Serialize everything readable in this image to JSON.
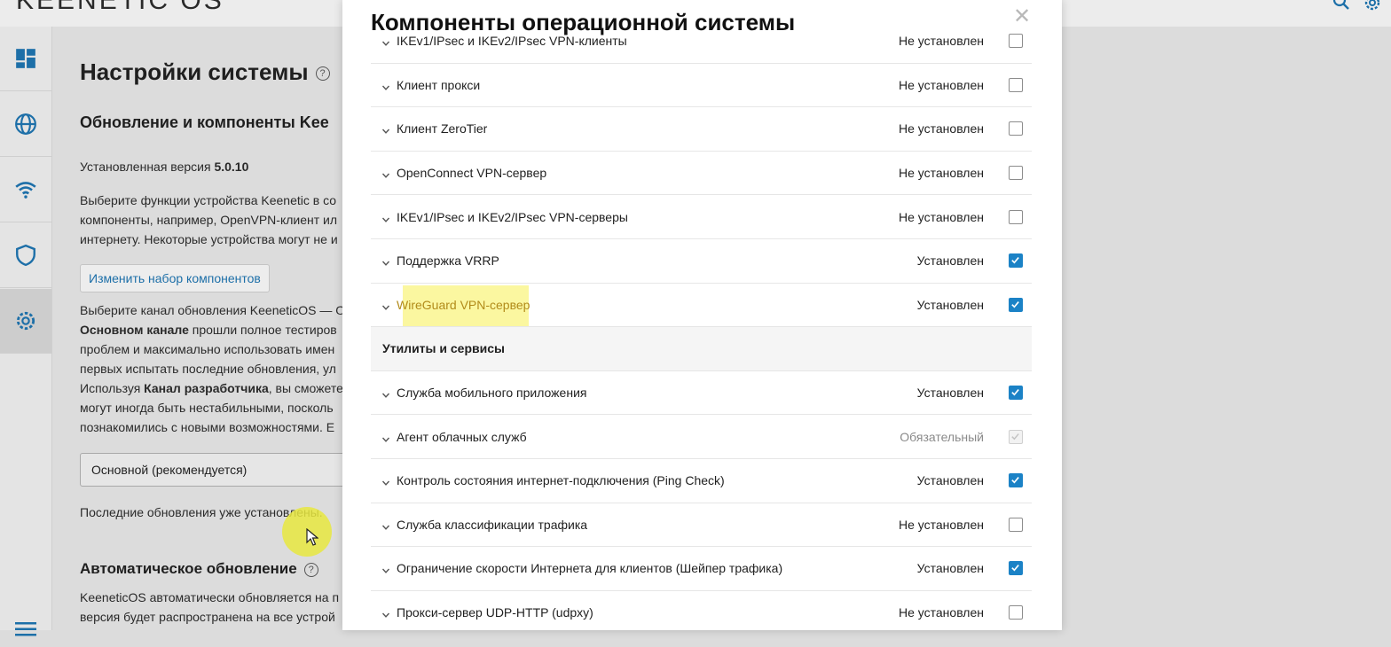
{
  "app": {
    "brand": "KEENETIC OS",
    "top_icons": [
      "search-icon",
      "gear-icon"
    ],
    "accent_color": "#1b82c6"
  },
  "sidebar": {
    "items": [
      {
        "id": "dashboard",
        "icon": "dashboard-icon"
      },
      {
        "id": "internet",
        "icon": "globe-icon"
      },
      {
        "id": "wifi",
        "icon": "wifi-icon"
      },
      {
        "id": "security",
        "icon": "shield-icon"
      },
      {
        "id": "settings",
        "icon": "gear-icon",
        "active": true
      }
    ],
    "menu_icon": "hamburger-icon"
  },
  "background_page": {
    "title": "Настройки системы",
    "section_title": "Обновление и компоненты Kee",
    "version_label": "Установленная версия ",
    "version_value": "5.0.10",
    "desc_lines": [
      "Выберите функции устройства Keenetic в со",
      "компоненты, например, OpenVPN-клиент ил",
      "интернету. Некоторые устройства могут не и"
    ],
    "change_button": "Изменить набор компонентов",
    "channel_lines": [
      {
        "normal": "Выберите канал обновления KeeneticOS — О",
        "bold": ""
      },
      {
        "bold": "Основном канале",
        "normal": " прошли полное тестиров"
      },
      {
        "normal": "проблем и максимально использовать имен",
        "bold": ""
      },
      {
        "normal": "первых испытать последние обновления, ул",
        "bold": ""
      },
      {
        "normal": "Используя ",
        "bold": "Канал разработчика",
        "normal2": ", вы сможете"
      },
      {
        "normal": "могут иногда быть нестабильными, посколь",
        "bold": ""
      },
      {
        "normal": "познакомились с новыми возможностями. Е",
        "bold": ""
      }
    ],
    "channel_select_value": "Основной (рекомендуется)",
    "updates_status": "Последние обновления уже установлены.",
    "auto_update_title": "Автоматическое обновление",
    "auto_lines": [
      "KeeneticOS автоматически обновляется на п",
      "версия будет распространена на все устрой"
    ]
  },
  "modal": {
    "title": "Компоненты операционной системы",
    "close_icon": "close-icon",
    "rows": [
      {
        "kind": "item",
        "name": "IKEv1/IPsec и IKEv2/IPsec VPN-клиенты",
        "status": "Не установлен",
        "state": "unchecked"
      },
      {
        "kind": "item",
        "name": "Клиент прокси",
        "status": "Не установлен",
        "state": "unchecked"
      },
      {
        "kind": "item",
        "name": "Клиент ZeroTier",
        "status": "Не установлен",
        "state": "unchecked"
      },
      {
        "kind": "item",
        "name": "OpenConnect VPN-сервер",
        "status": "Не установлен",
        "state": "unchecked"
      },
      {
        "kind": "item",
        "name": "IKEv1/IPsec и IKEv2/IPsec VPN-серверы",
        "status": "Не установлен",
        "state": "unchecked"
      },
      {
        "kind": "item",
        "name": "Поддержка VRRP",
        "status": "Установлен",
        "state": "checked"
      },
      {
        "kind": "item",
        "name": "WireGuard VPN-сервер",
        "status": "Установлен",
        "state": "checked",
        "highlighted": true
      },
      {
        "kind": "group",
        "name": "Утилиты и сервисы"
      },
      {
        "kind": "item",
        "name": "Служба мобильного приложения",
        "status": "Установлен",
        "state": "checked"
      },
      {
        "kind": "item",
        "name": "Агент облачных служб",
        "status": "Обязательный",
        "state": "disabled"
      },
      {
        "kind": "item",
        "name": "Контроль состояния интернет-подключения (Ping Check)",
        "status": "Установлен",
        "state": "checked"
      },
      {
        "kind": "item",
        "name": "Служба классификации трафика",
        "status": "Не установлен",
        "state": "unchecked"
      },
      {
        "kind": "item",
        "name": "Ограничение скорости Интернета для клиентов (Шейпер трафика)",
        "status": "Установлен",
        "state": "checked"
      },
      {
        "kind": "item",
        "name": "Прокси-сервер UDP-HTTP (udpxy)",
        "status": "Не установлен",
        "state": "unchecked"
      }
    ]
  }
}
